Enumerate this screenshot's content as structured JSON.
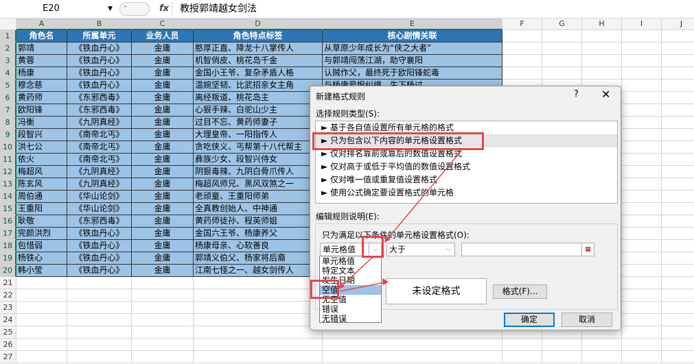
{
  "formula_bar": {
    "name_box": "E20",
    "fx_label": "fx",
    "content": "教授郭靖越女剑法",
    "namebox_arrow": "▼",
    "ctrl": "⌃"
  },
  "columns": [
    "A",
    "B",
    "C",
    "D",
    "E",
    "F",
    "G",
    "H",
    "I",
    "J"
  ],
  "rows": [
    "1",
    "2",
    "3",
    "4",
    "5",
    "6",
    "7",
    "8",
    "9",
    "10",
    "11",
    "12",
    "13",
    "14",
    "15",
    "16",
    "17",
    "18",
    "19",
    "20",
    "21",
    "22",
    "23",
    "24",
    "25",
    "26",
    "27"
  ],
  "table": {
    "headers": [
      "角色名",
      "所属单元",
      "业务人员",
      "角色特点标签",
      "核心剧情关联"
    ],
    "rows": [
      [
        "郭靖",
        "《铁血丹心》",
        "金庸",
        "憨厚正直、降龙十八掌传人",
        "从草原少年成长为“侠之大者”"
      ],
      [
        "黄蓉",
        "《铁血丹心》",
        "金庸",
        "机智俏皮、桃花岛千金",
        "与郭靖闯荡江湖，助守襄阳"
      ],
      [
        "杨康",
        "《铁血丹心》",
        "金庸",
        "金国小王爷、复杂矛盾人格",
        "认贼作父，最终死于欧阳锋蛇毒"
      ],
      [
        "穆念慈",
        "《铁血丹心》",
        "金庸",
        "温婉坚韧、比武招亲女主角",
        "与杨康爱恨纠缠，生下杨过"
      ],
      [
        "黄药师",
        "《东邪西毒》",
        "金庸",
        "离经叛道、桃花岛主",
        ""
      ],
      [
        "欧阳锋",
        "《东邪西毒》",
        "金庸",
        "心狠手辣、白驼山少主",
        ""
      ],
      [
        "冯衡",
        "《九阴真经》",
        "金庸",
        "过目不忘、黄药师妻子",
        ""
      ],
      [
        "段智兴",
        "《南帝北丐》",
        "金庸",
        "大理皇帝、一阳指传人",
        ""
      ],
      [
        "洪七公",
        "《南帝北丐》",
        "金庸",
        "贪吃侠义、丐帮第十八代帮主",
        ""
      ],
      [
        "依火",
        "《南帝北丐》",
        "金庸",
        "彝族少女、段智兴侍女",
        ""
      ],
      [
        "梅超风",
        "《九阴真经》",
        "金庸",
        "阴狠毒辣、九阴白骨爪传人",
        ""
      ],
      [
        "陈玄风",
        "《九阴真经》",
        "金庸",
        "梅超风师兄、黑风双煞之一",
        ""
      ],
      [
        "周伯通",
        "《华山论剑》",
        "金庸",
        "老顽童、王重阳师弟",
        ""
      ],
      [
        "王重阳",
        "《华山论剑》",
        "金庸",
        "全真教创始人、中神通",
        ""
      ],
      [
        "耿敬",
        "《东邪西毒》",
        "金庸",
        "黄药师徒孙、程英师姐",
        ""
      ],
      [
        "完颜洪烈",
        "《铁血丹心》",
        "金庸",
        "金国六王爷、杨康养父",
        ""
      ],
      [
        "包惜弱",
        "《铁血丹心》",
        "金庸",
        "杨康母亲、心软善良",
        ""
      ],
      [
        "杨铁心",
        "《铁血丹心》",
        "金庸",
        "郭靖义伯父、杨家将后裔",
        ""
      ],
      [
        "韩小莹",
        "《铁血丹心》",
        "金庸",
        "江南七怪之一、越女剑传人",
        ""
      ]
    ]
  },
  "dialog": {
    "title": "新建格式规则",
    "help": "?",
    "close": "✕",
    "select_type_label": "选择规则类型(S):",
    "rule_types": [
      "► 基于各自值设置所有单元格的格式",
      "► 只为包含以下内容的单元格设置格式",
      "► 仅对排名靠前或靠后的数值设置格式",
      "► 仅对高于或低于平均值的数值设置格式",
      "► 仅对唯一值或重复值设置格式",
      "► 使用公式确定要设置格式的单元格"
    ],
    "edit_label": "编辑规则说明(E):",
    "condition_label": "只为满足以下条件的单元格设置格式(O):",
    "combo1_value": "单元格值",
    "combo2_value": "大于",
    "dropdown_items": [
      "单元格值",
      "特定文本",
      "发生日期",
      "空值",
      "无空值",
      "错误",
      "无错误"
    ],
    "preview_text": "未设定格式",
    "format_button": "格式(F)...",
    "ok_button": "确定",
    "cancel_button": "取消",
    "chevron": "⌵"
  },
  "colors": {
    "header_fill": "#2e75b6",
    "data_fill": "#9dc3e6",
    "highlight": "#e0474c"
  }
}
